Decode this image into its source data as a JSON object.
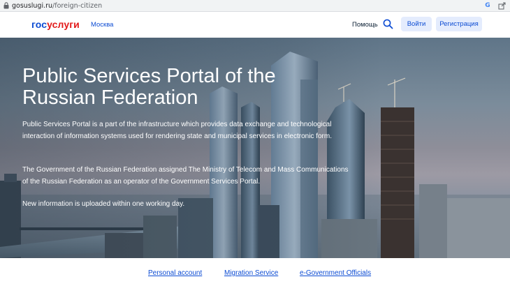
{
  "browser": {
    "url_host": "gosuslugi.ru",
    "url_path": "/foreign-citizen",
    "google_letter": "G"
  },
  "header": {
    "logo_part1": "гос",
    "logo_part2": "услуги",
    "city": "Москва",
    "help": "Помощь",
    "login": "Войти",
    "register": "Регистрация"
  },
  "hero": {
    "title": "Public Services Portal of the Russian Federation",
    "paragraph1": "Public Services Portal is a part of the infrastructure which provides data exchange and technological interaction of information systems used for rendering state and municipal services in electronic form.",
    "paragraph2": "The Government of the Russian Federation assigned The Ministry of Telecom and Mass Communications of the Russian Federation as an operator of the Government Services Portal.",
    "paragraph3": "New information is uploaded within one working day."
  },
  "footer": {
    "links": [
      "Personal account",
      "Migration Service",
      "e-Government Officials"
    ]
  },
  "colors": {
    "brand_blue": "#0d4cd3",
    "brand_red": "#e21a1a",
    "button_bg": "#e4ecfd"
  },
  "icons": [
    "lock-icon",
    "google-icon",
    "share-icon",
    "search-icon"
  ]
}
